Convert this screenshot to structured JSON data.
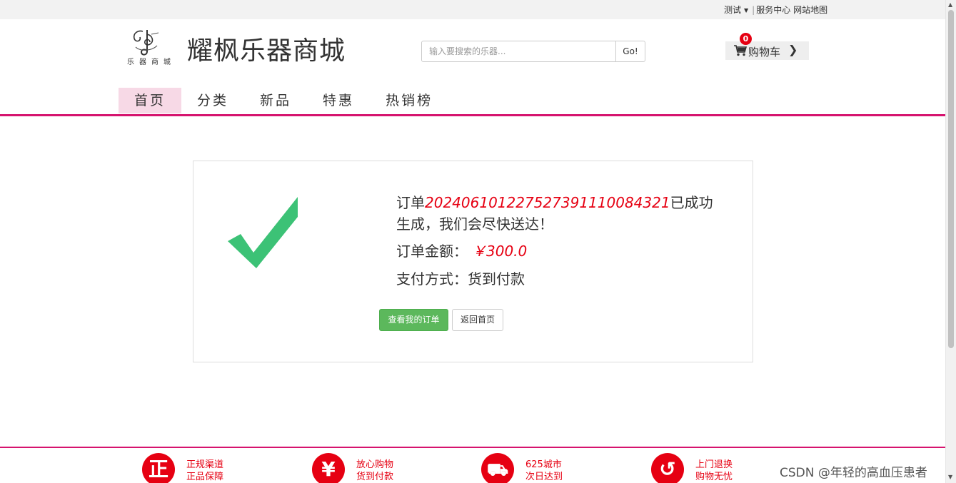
{
  "topbar": {
    "test": "测试",
    "service": "服务中心",
    "sitemap": "网站地图"
  },
  "header": {
    "site_title": "耀枫乐器商城",
    "logo_text": "乐器商城",
    "search_placeholder": "输入要搜索的乐器...",
    "search_button": "Go!",
    "cart_label": "购物车",
    "cart_count": "0"
  },
  "nav": {
    "items": [
      "首页",
      "分类",
      "新品",
      "特惠",
      "热销榜"
    ],
    "active": 0
  },
  "success": {
    "order_prefix": "订单",
    "order_no": "20240610122752739111008432 1",
    "order_suffix": "已成功生成，我们会尽快送达！",
    "amount_label": "订单金额：",
    "amount_value": "￥300.0",
    "pay_label": "支付方式：货到付款",
    "btn_orders": "查看我的订单",
    "btn_home": "返回首页"
  },
  "footer": {
    "features": [
      {
        "icon": "zheng-icon",
        "glyph": "正",
        "line1": "正规渠道",
        "line2": "正品保障"
      },
      {
        "icon": "yen-icon",
        "glyph": "¥",
        "line1": "放心购物",
        "line2": "货到付款"
      },
      {
        "icon": "truck-icon",
        "glyph": "⛟",
        "line1": "625城市",
        "line2": "次日达到"
      },
      {
        "icon": "return-icon",
        "glyph": "↺",
        "line1": "上门退换",
        "line2": "购物无忧"
      }
    ],
    "watermark": "CSDN @年轻的高血压患者"
  },
  "colors": {
    "brand_pink": "#d6136e",
    "accent_red": "#e60012",
    "check_green": "#3cc276",
    "button_green": "#5cb85c"
  }
}
